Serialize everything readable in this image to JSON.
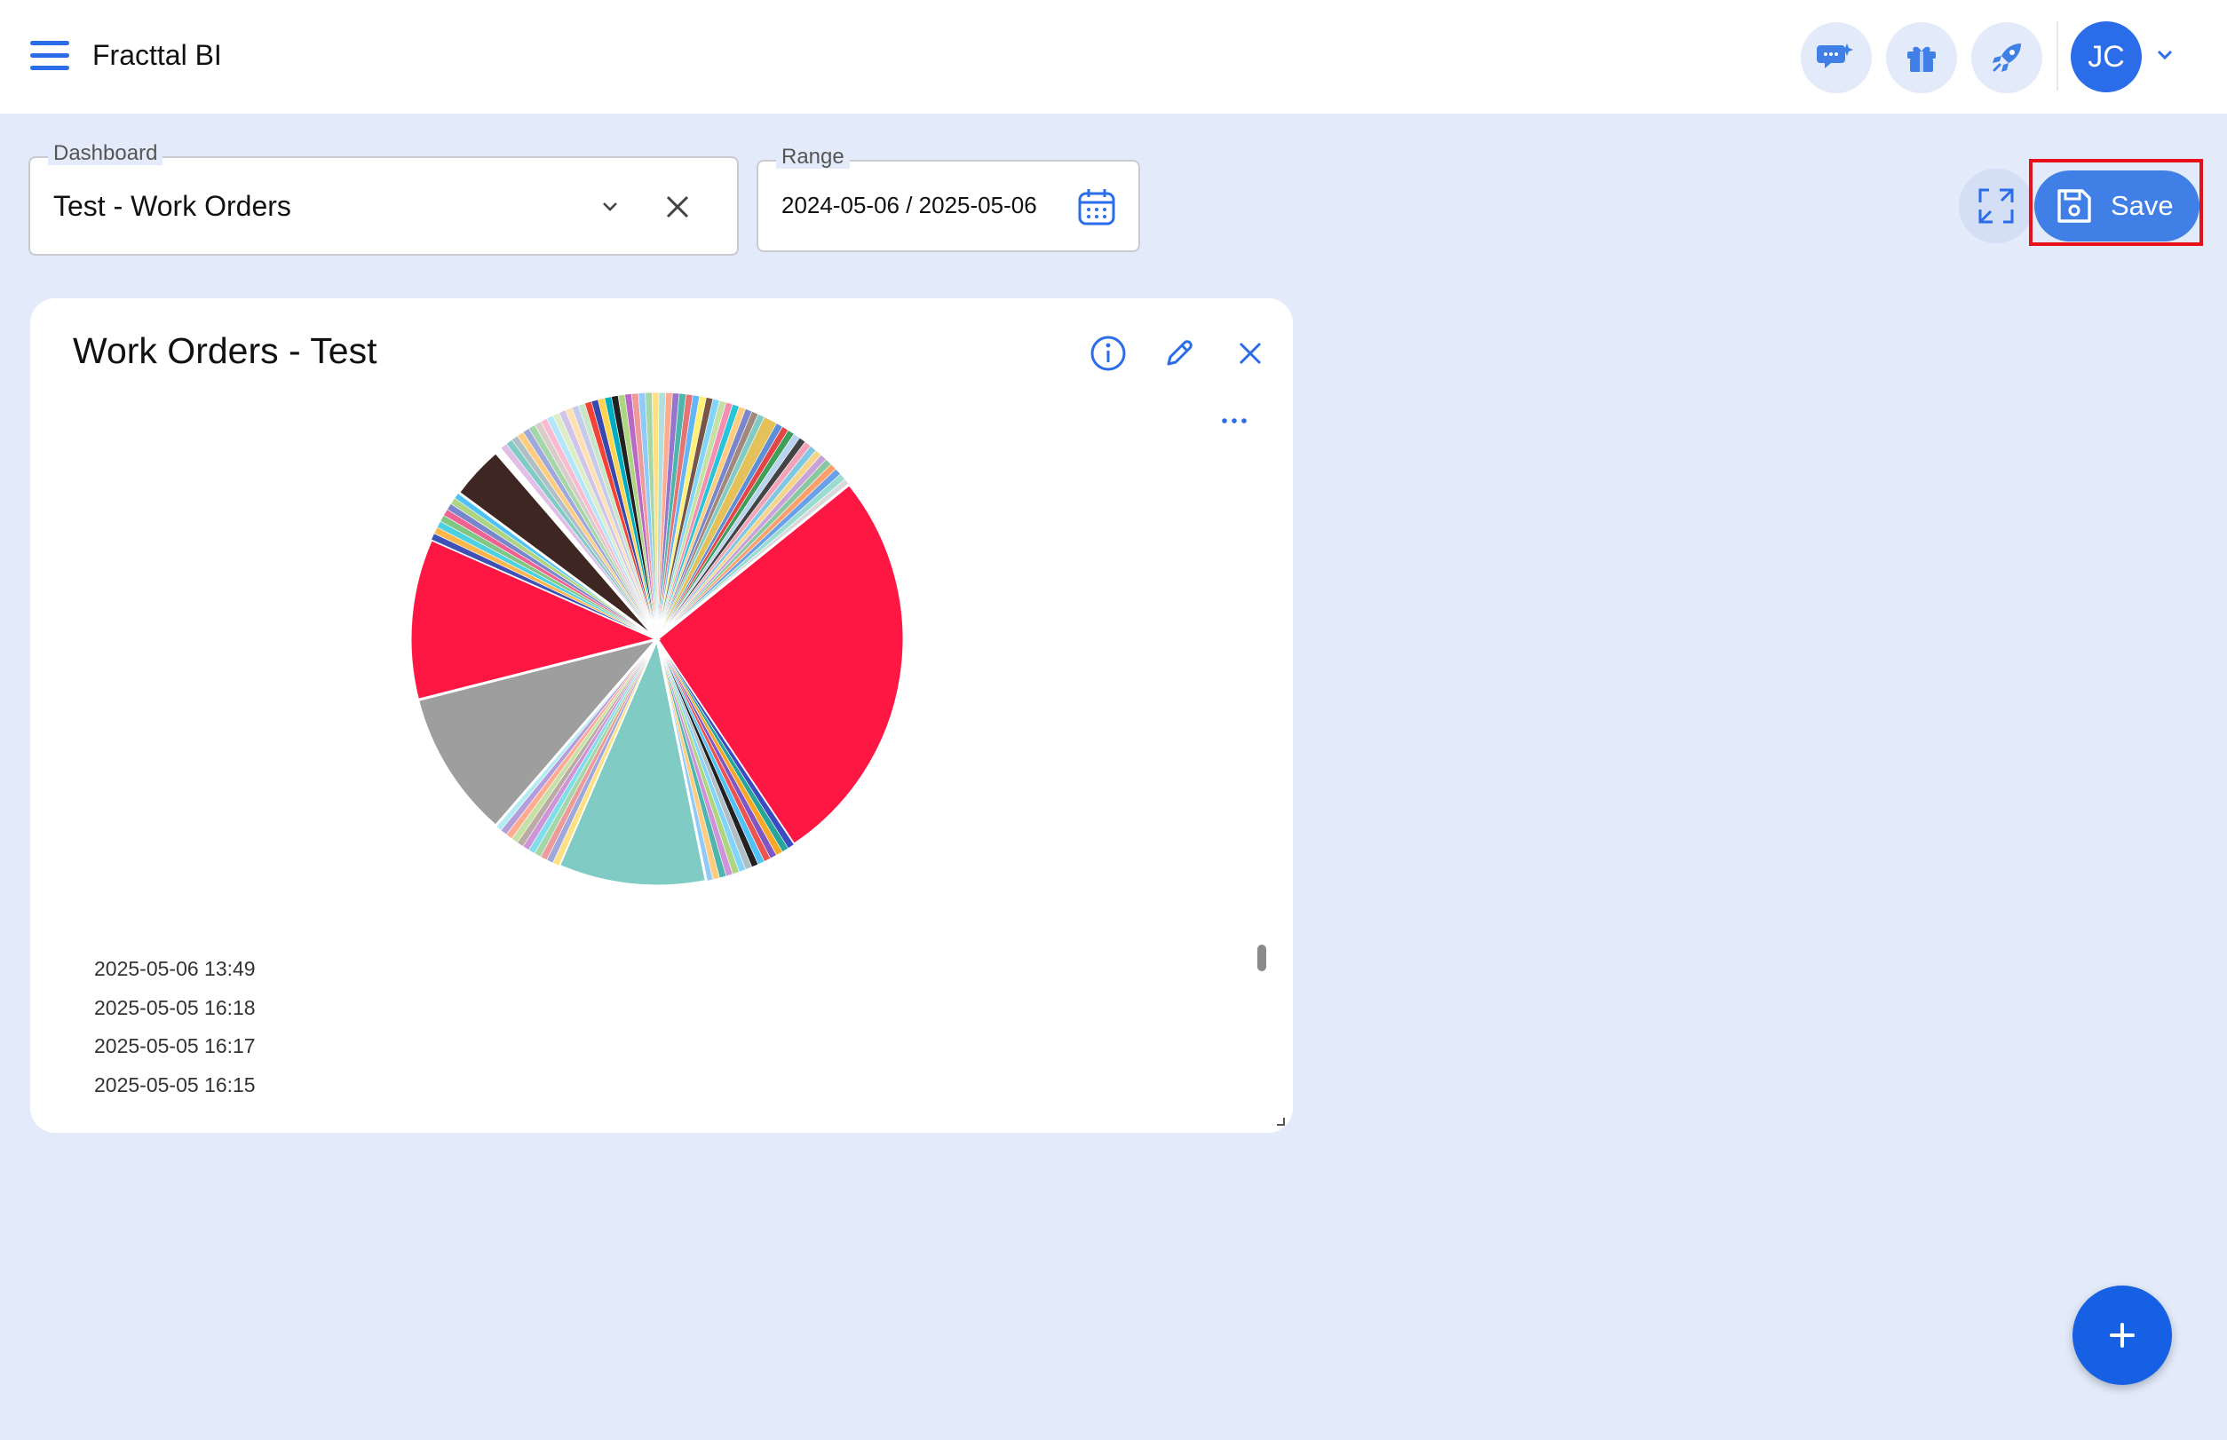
{
  "app": {
    "title": "Fracttal BI"
  },
  "header": {
    "icons": [
      "chat-sparkle-icon",
      "gift-icon",
      "rocket-icon"
    ],
    "user_initials": "JC"
  },
  "filters": {
    "dashboard_label": "Dashboard",
    "dashboard_value": "Test - Work Orders",
    "range_label": "Range",
    "range_value": "2024-05-06 / 2025-05-06"
  },
  "toolbar": {
    "save_label": "Save"
  },
  "widget": {
    "title": "Work Orders - Test",
    "legend": [
      "2025-05-06 13:49",
      "2025-05-05 16:18",
      "2025-05-05 16:17",
      "2025-05-05 16:15"
    ]
  },
  "colors": {
    "accent": "#2b6de8",
    "background": "#e3ebfb",
    "highlight": "#e8101a"
  },
  "chart_data": {
    "type": "pie",
    "title": "",
    "note": "Many thin slices (one per work-order timestamp); relative sizes estimated from visible wedge angles.",
    "slices": [
      {
        "value": 2,
        "color": "#e5c15a"
      },
      {
        "value": 1,
        "color": "#5e8fd6"
      },
      {
        "value": 1,
        "color": "#e64545"
      },
      {
        "value": 1,
        "color": "#3f9f5a"
      },
      {
        "value": 1,
        "color": "#b8d4f0"
      },
      {
        "value": 1,
        "color": "#444444"
      },
      {
        "value": 1,
        "color": "#f2a3b8"
      },
      {
        "value": 1,
        "color": "#7ec8e3"
      },
      {
        "value": 1,
        "color": "#f5d58a"
      },
      {
        "value": 1,
        "color": "#c8a2d8"
      },
      {
        "value": 1,
        "color": "#88c9a1"
      },
      {
        "value": 1,
        "color": "#ff9f6b"
      },
      {
        "value": 1,
        "color": "#6aa0e8"
      },
      {
        "value": 1,
        "color": "#9bdcd0"
      },
      {
        "value": 1,
        "color": "#d9d9d9"
      },
      {
        "value": 60,
        "color": "#ff1744"
      },
      {
        "value": 1,
        "color": "#3b4cc0"
      },
      {
        "value": 1,
        "color": "#26a69a"
      },
      {
        "value": 1,
        "color": "#f9a825"
      },
      {
        "value": 1,
        "color": "#7e57c2"
      },
      {
        "value": 1,
        "color": "#ef5350"
      },
      {
        "value": 1,
        "color": "#4fc3f7"
      },
      {
        "value": 1,
        "color": "#212121"
      },
      {
        "value": 1,
        "color": "#b0bec5"
      },
      {
        "value": 1,
        "color": "#81d4fa"
      },
      {
        "value": 1,
        "color": "#aed581"
      },
      {
        "value": 1,
        "color": "#ce93d8"
      },
      {
        "value": 1,
        "color": "#4db6ac"
      },
      {
        "value": 1,
        "color": "#ffcc80"
      },
      {
        "value": 1,
        "color": "#90caf9"
      },
      {
        "value": 22,
        "color": "#80cbc4"
      },
      {
        "value": 1,
        "color": "#ffe082"
      },
      {
        "value": 1,
        "color": "#9fa8da"
      },
      {
        "value": 1,
        "color": "#ef9a9a"
      },
      {
        "value": 1,
        "color": "#a5d6a7"
      },
      {
        "value": 1,
        "color": "#80deea"
      },
      {
        "value": 1,
        "color": "#ce93d8"
      },
      {
        "value": 1,
        "color": "#bcaaa4"
      },
      {
        "value": 1,
        "color": "#c5e1a5"
      },
      {
        "value": 1,
        "color": "#ffab91"
      },
      {
        "value": 1,
        "color": "#b39ddb"
      },
      {
        "value": 1,
        "color": "#b2ebf2"
      },
      {
        "value": 22,
        "color": "#9e9e9e"
      },
      {
        "value": 24,
        "color": "#ff1744"
      },
      {
        "value": 1,
        "color": "#3f51b5"
      },
      {
        "value": 1,
        "color": "#ffb74d"
      },
      {
        "value": 1,
        "color": "#4dd0e1"
      },
      {
        "value": 1,
        "color": "#81c784"
      },
      {
        "value": 1,
        "color": "#f06292"
      },
      {
        "value": 1,
        "color": "#7986cb"
      },
      {
        "value": 1,
        "color": "#aed581"
      },
      {
        "value": 1,
        "color": "#4fc3f7"
      },
      {
        "value": 8,
        "color": "#3e2723"
      },
      {
        "value": 1,
        "color": "#ffffff"
      },
      {
        "value": 1,
        "color": "#e1bee7"
      },
      {
        "value": 1,
        "color": "#80cbc4"
      },
      {
        "value": 1,
        "color": "#b0bec5"
      },
      {
        "value": 1,
        "color": "#ffcc80"
      },
      {
        "value": 1,
        "color": "#9fa8da"
      },
      {
        "value": 1,
        "color": "#a5d6a7"
      },
      {
        "value": 1,
        "color": "#d7ccc8"
      },
      {
        "value": 1,
        "color": "#f8bbd0"
      },
      {
        "value": 1,
        "color": "#b3e5fc"
      },
      {
        "value": 1,
        "color": "#dcedc8"
      },
      {
        "value": 1,
        "color": "#d1c4e9"
      },
      {
        "value": 1,
        "color": "#ffe0b2"
      },
      {
        "value": 1,
        "color": "#c5cae9"
      },
      {
        "value": 1,
        "color": "#c8e6c9"
      },
      {
        "value": 1,
        "color": "#f44336"
      },
      {
        "value": 1,
        "color": "#3949ab"
      },
      {
        "value": 1,
        "color": "#ffd54f"
      },
      {
        "value": 1,
        "color": "#00acc1"
      },
      {
        "value": 1,
        "color": "#212121"
      },
      {
        "value": 1,
        "color": "#aed581"
      },
      {
        "value": 1,
        "color": "#ba68c8"
      },
      {
        "value": 1,
        "color": "#ef9a9a"
      },
      {
        "value": 1,
        "color": "#90caf9"
      },
      {
        "value": 1,
        "color": "#a5d6a7"
      },
      {
        "value": 1,
        "color": "#ffe082"
      },
      {
        "value": 1,
        "color": "#b2dfdb"
      },
      {
        "value": 1,
        "color": "#ffab91"
      },
      {
        "value": 1,
        "color": "#9575cd"
      },
      {
        "value": 1,
        "color": "#4db6ac"
      },
      {
        "value": 1,
        "color": "#e57373"
      },
      {
        "value": 1,
        "color": "#64b5f6"
      },
      {
        "value": 1,
        "color": "#fff176"
      },
      {
        "value": 1,
        "color": "#795548"
      },
      {
        "value": 1,
        "color": "#81d4fa"
      },
      {
        "value": 1,
        "color": "#c5e1a5"
      },
      {
        "value": 1,
        "color": "#f48fb1"
      },
      {
        "value": 1,
        "color": "#26c6da"
      },
      {
        "value": 1,
        "color": "#ffcc80"
      },
      {
        "value": 1,
        "color": "#7986cb"
      },
      {
        "value": 1,
        "color": "#a1887f"
      },
      {
        "value": 1,
        "color": "#80cbc4"
      }
    ]
  }
}
